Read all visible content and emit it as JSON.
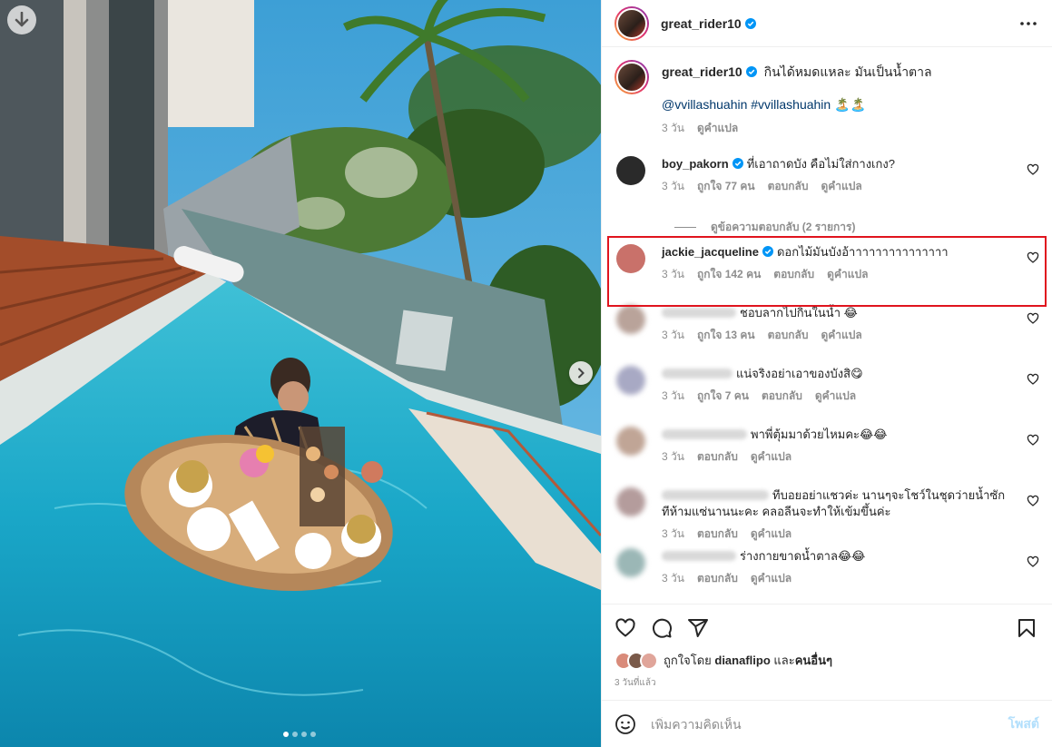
{
  "post": {
    "username": "great_rider10",
    "caption": "กินได้หมดแหละ มันเป็นน้ำตาล",
    "caption_tags": "@vvillashuahin #vvillashuahin 🏝️🏝️",
    "caption_time": "3 วัน",
    "caption_translate": "ดูคำแปล",
    "carousel_count": 4,
    "carousel_active": 0
  },
  "comments": [
    {
      "username": "boy_pakorn",
      "verified": true,
      "text": "ที่เอาถาดบัง คือไม่ใส่กางเกง?",
      "time": "3 วัน",
      "likes": "ถูกใจ 77 คน",
      "reply": "ตอบกลับ",
      "translate": "ดูคำแปล",
      "blurred": false,
      "avatar_color": "#2a2a2a"
    },
    {
      "username": "jackie_jacqueline",
      "verified": true,
      "text": "ดอกไม้มันบังอ้าาาาาาาาาาาาาาา",
      "time": "3 วัน",
      "likes": "ถูกใจ 142 คน",
      "reply": "ตอบกลับ",
      "translate": "ดูคำแปล",
      "blurred": false,
      "avatar_color": "#c9716a"
    },
    {
      "username": "",
      "verified": false,
      "text": "ชอบลากไปกินในน้ำ 😂",
      "time": "3 วัน",
      "likes": "ถูกใจ 13 คน",
      "reply": "ตอบกลับ",
      "translate": "ดูคำแปล",
      "blurred": true,
      "avatar_color": "#b9a39a"
    },
    {
      "username": "",
      "verified": false,
      "text": "แน่จริงอย่าเอาของบังสิ😋",
      "time": "3 วัน",
      "likes": "ถูกใจ 7 คน",
      "reply": "ตอบกลับ",
      "translate": "ดูคำแปล",
      "blurred": true,
      "avatar_color": "#a8a9c4"
    },
    {
      "username": "",
      "verified": false,
      "text": "พาพี่ตุ้มมาด้วยไหมคะ😂😂",
      "time": "3 วัน",
      "likes": "",
      "reply": "ตอบกลับ",
      "translate": "ดูคำแปล",
      "blurred": true,
      "avatar_color": "#c0a596"
    },
    {
      "username": "",
      "verified": false,
      "text": "ทีบอยอย่าแชวค่ะ นานๆจะโชว์ในชุดว่ายน้ำซักทีห้ามแซ่นานนะคะ คลอลีนจะทำให้เข้มขึ้นค่ะ",
      "time": "3 วัน",
      "likes": "",
      "reply": "ตอบกลับ",
      "translate": "ดูคำแปล",
      "blurred": true,
      "avatar_color": "#b49c9c"
    },
    {
      "username": "",
      "verified": false,
      "text": "ร่างกายขาดน้ำตาล😂😂",
      "time": "3 วัน",
      "likes": "",
      "reply": "ตอบกลับ",
      "translate": "ดูคำแปล",
      "blurred": true,
      "avatar_color": "#9bb7b6"
    }
  ],
  "view_replies": "ดูข้อความตอบกลับ (2 รายการ)",
  "liked_by": {
    "prefix": "ถูกใจโดย",
    "user": "dianaflipo",
    "joiner": "และ",
    "others": "คนอื่นๆ"
  },
  "time_ago": "3 วันที่แล้ว",
  "add_comment": {
    "placeholder": "เพิ่มความคิดเห็น",
    "post_label": "โพสต์"
  },
  "colors": {
    "highlight": "#e0141e",
    "link": "#00376b",
    "verified": "#0095f6",
    "muted": "#8e8e8e"
  }
}
